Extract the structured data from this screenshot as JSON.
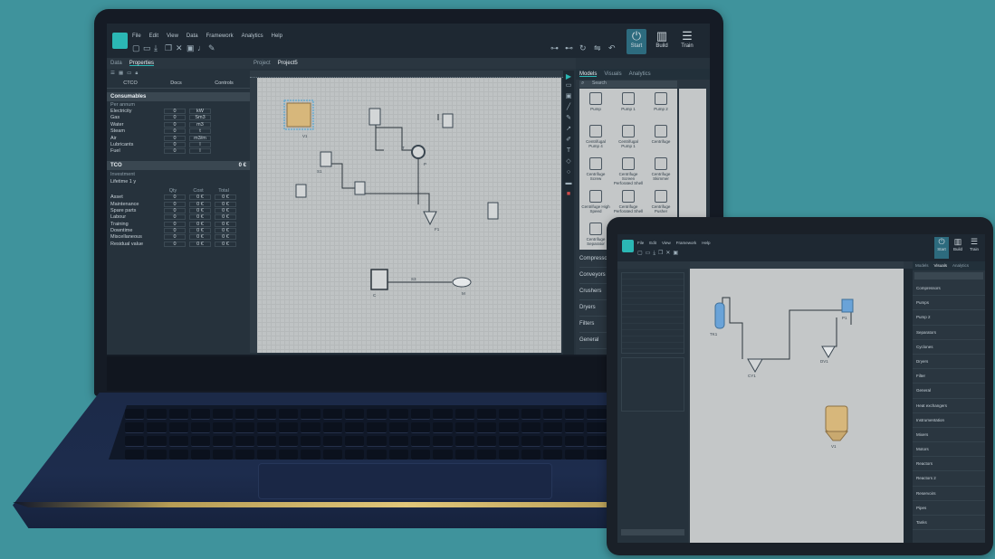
{
  "laptop": {
    "menu": [
      "File",
      "Edit",
      "View",
      "Data",
      "Framework",
      "Analytics",
      "Help"
    ],
    "ribbon_buttons": [
      {
        "label": "Start",
        "icon": "power-icon"
      },
      {
        "label": "Build",
        "icon": "bars-icon"
      },
      {
        "label": "Train",
        "icon": "stack-icon"
      }
    ],
    "left_tabs": [
      "Data",
      "Properties"
    ],
    "doc_tabs": [
      "Project",
      "Project5"
    ],
    "right_tabs": [
      "Models",
      "Visuals",
      "Analytics"
    ],
    "sub_tabs": [
      "CTCO",
      "Docs",
      "Controls"
    ],
    "consumables": {
      "title": "Consumables",
      "subtitle": "Per annum",
      "rows": [
        {
          "name": "Electricity",
          "value": "0",
          "unit": "kW"
        },
        {
          "name": "Gas",
          "value": "0",
          "unit": "Sm3"
        },
        {
          "name": "Water",
          "value": "0",
          "unit": "m3"
        },
        {
          "name": "Steam",
          "value": "0",
          "unit": "t"
        },
        {
          "name": "Air",
          "value": "0",
          "unit": "m3/m"
        },
        {
          "name": "Lubricants",
          "value": "0",
          "unit": "l"
        },
        {
          "name": "Fuel",
          "value": "0",
          "unit": "l"
        }
      ]
    },
    "tco": {
      "label": "TCO",
      "value": "0 €"
    },
    "lifetime": {
      "label": "Investment",
      "value": "Lifetime 1  y"
    },
    "costs_headers": [
      "Qty",
      "Cost",
      "Total"
    ],
    "costs": [
      {
        "name": "Asset",
        "qty": "0",
        "cost": "0 €",
        "total": "0 €"
      },
      {
        "name": "Maintenance",
        "qty": "0",
        "cost": "0 €",
        "total": "0 €"
      },
      {
        "name": "Spare parts",
        "qty": "0",
        "cost": "0 €",
        "total": "0 €"
      },
      {
        "name": "Labour",
        "qty": "0",
        "cost": "0 €",
        "total": "0 €"
      },
      {
        "name": "Training",
        "qty": "0",
        "cost": "0 €",
        "total": "0 €"
      },
      {
        "name": "Downtime",
        "qty": "0",
        "cost": "0 €",
        "total": "0 €"
      },
      {
        "name": "Miscellaneous",
        "qty": "0",
        "cost": "0 €",
        "total": "0 €"
      },
      {
        "name": "Residual value",
        "qty": "0",
        "cost": "0 €",
        "total": "0 €"
      }
    ],
    "search_placeholder": "Search",
    "models": [
      "Pump",
      "Pump 1",
      "Pump 2",
      "Centrifugal Pump 4",
      "Centrifugal Pump 1",
      "Centrifuge",
      "Centrifuge Screw",
      "Centrifuge Screen Perforated Shell",
      "Centrifuge Skimmer",
      "Centrifuge High Speed",
      "Centrifuge Perforated Shell",
      "Centrifuge Pusher",
      "Centrifuge Separator",
      "",
      ""
    ],
    "categories": [
      "Compressors",
      "Conveyors",
      "Crushers",
      "Dryers",
      "Filters",
      "General"
    ],
    "diagram_labels": [
      "V1",
      "T",
      "P",
      "S1",
      "F1",
      "M",
      "C"
    ],
    "canvas_stream_label": "S3"
  },
  "tablet": {
    "menu": [
      "File",
      "Edit",
      "View",
      "Framework",
      "Help"
    ],
    "ribbon_buttons": [
      "Start",
      "Build",
      "Train"
    ],
    "right_tabs": [
      "Models",
      "Visuals",
      "Analytics"
    ],
    "categories": [
      "Compressors",
      "Pumps",
      "Pump 2",
      "Separators",
      "Cyclones",
      "Dryers",
      "Filter",
      "General",
      "Heat exchangers",
      "Instrumentation",
      "Mixers",
      "Motors",
      "Reactors",
      "Reactors 2",
      "Reservoirs",
      "Pipes",
      "Tanks"
    ],
    "diagram_labels": [
      "TK1",
      "V1",
      "CY1",
      "P1",
      "DV1"
    ]
  }
}
